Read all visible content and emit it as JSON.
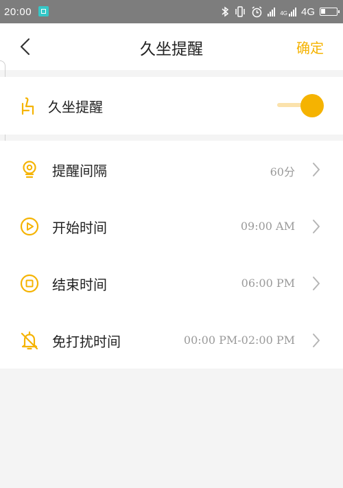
{
  "status_bar": {
    "time": "20:00",
    "network": "4G",
    "icons": [
      "app-icon",
      "bluetooth-icon",
      "vibrate-icon",
      "alarm-icon",
      "signal-icon",
      "signal-4g-icon",
      "battery-icon"
    ]
  },
  "header": {
    "title": "久坐提醒",
    "confirm_label": "确定"
  },
  "main_toggle": {
    "label": "久坐提醒",
    "enabled": true
  },
  "settings": [
    {
      "label": "提醒间隔",
      "value": "60分",
      "icon": "bulb-icon"
    },
    {
      "label": "开始时间",
      "value": "09:00 AM",
      "icon": "play-icon"
    },
    {
      "label": "结束时间",
      "value": "06:00 PM",
      "icon": "stop-icon"
    },
    {
      "label": "免打扰时间",
      "value": "00:00 PM-02:00 PM",
      "icon": "bell-off-icon"
    }
  ],
  "colors": {
    "accent": "#f5b301",
    "accent_light": "#fbe2ac",
    "status_bar_bg": "#7d7d7d",
    "page_bg": "#f4f4f4",
    "value_text": "#9a9a9a"
  }
}
